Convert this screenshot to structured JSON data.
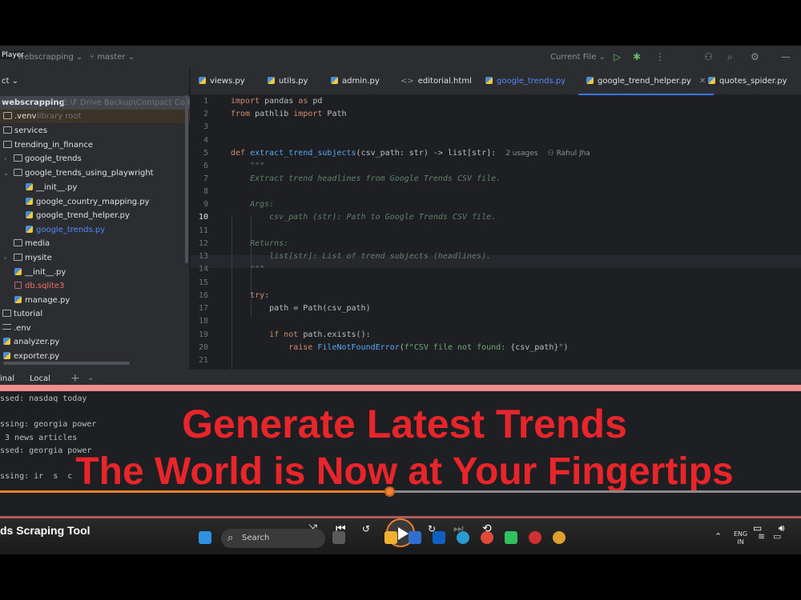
{
  "titlebar": {
    "player_label": "Player",
    "project": "webscrapping",
    "branch": "master",
    "run_config": "Current File"
  },
  "project_panel": {
    "header": "ct",
    "items": [
      {
        "label": "webscrapping",
        "hint": "E:\\F Drive Backup\\Compact Codes",
        "kind": "folder",
        "selected": true
      },
      {
        "label": ".venv",
        "hint": "library root",
        "kind": "folder"
      },
      {
        "label": "services",
        "kind": "folder"
      },
      {
        "label": "trending_in_finance",
        "kind": "folder"
      },
      {
        "label": "google_trends",
        "kind": "folder"
      },
      {
        "label": "google_trends_using_playwright",
        "kind": "folder"
      },
      {
        "label": "__init__.py",
        "kind": "py"
      },
      {
        "label": "google_country_mapping.py",
        "kind": "py"
      },
      {
        "label": "google_trend_helper.py",
        "kind": "py"
      },
      {
        "label": "google_trends.py",
        "kind": "py"
      },
      {
        "label": "media",
        "kind": "folder"
      },
      {
        "label": "mysite",
        "kind": "folder"
      },
      {
        "label": "__init__.py",
        "kind": "py"
      },
      {
        "label": "db.sqlite3",
        "kind": "db"
      },
      {
        "label": "manage.py",
        "kind": "py"
      },
      {
        "label": "tutorial",
        "kind": "folder"
      },
      {
        "label": ".env",
        "kind": "file"
      },
      {
        "label": "analyzer.py",
        "kind": "py"
      },
      {
        "label": "exporter.py",
        "kind": "py"
      }
    ]
  },
  "tabs": [
    {
      "label": "views.py"
    },
    {
      "label": "utils.py"
    },
    {
      "label": "admin.py"
    },
    {
      "label": "editorial.html"
    },
    {
      "label": "google_trends.py"
    },
    {
      "label": "google_trend_helper.py",
      "active": true
    },
    {
      "label": "quotes_spider.py"
    }
  ],
  "editor": {
    "line_numbers": [
      "1",
      "2",
      "3",
      "4",
      "5",
      "6",
      "7",
      "8",
      "9",
      "10",
      "11",
      "12",
      "13",
      "14",
      "15",
      "16",
      "17",
      "18",
      "19",
      "20",
      "21"
    ],
    "current_line": "10",
    "usages_hint": "2 usages",
    "author_hint": "Rahul Jha"
  },
  "terminal": {
    "tab_label": "inal",
    "local_tab": "Local",
    "lines": [
      "ssed: nasdaq today",
      "",
      "ssing: georgia power",
      " 3 news articles",
      "ssed: georgia power",
      "",
      "ssing: ir  s  c"
    ]
  },
  "overlay": {
    "line1": "Generate Latest Trends",
    "line2": "The World is Now at Your Fingertips"
  },
  "player": {
    "video_title": "ds Scraping Tool",
    "progress": 0.486,
    "search_placeholder": "Search",
    "language_top": "ENG",
    "language_bottom": "IN"
  },
  "colors": {
    "accent": "#3574f0",
    "caption": "#e8252a",
    "progress": "#f08030"
  }
}
